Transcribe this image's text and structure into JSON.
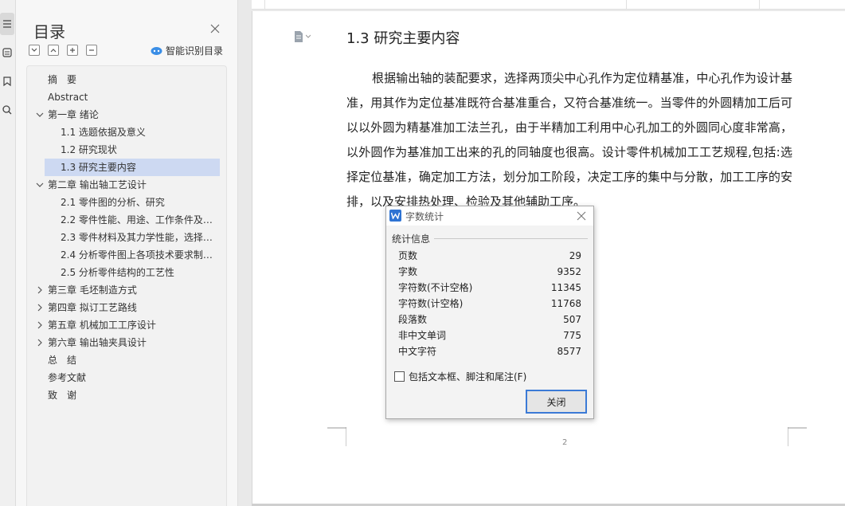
{
  "toc": {
    "title": "目录",
    "smart_label": "智能识别目录",
    "items": [
      {
        "label": "摘　要",
        "level": 0,
        "expander": "none",
        "selected": false
      },
      {
        "label": "Abstract",
        "level": 0,
        "expander": "none",
        "selected": false
      },
      {
        "label": "第一章 绪论",
        "level": 0,
        "expander": "expanded",
        "selected": false
      },
      {
        "label": "1.1 选题依据及意义",
        "level": 1,
        "expander": "none",
        "selected": false
      },
      {
        "label": "1.2 研究现状",
        "level": 1,
        "expander": "none",
        "selected": false
      },
      {
        "label": "1.3 研究主要内容",
        "level": 1,
        "expander": "none",
        "selected": true
      },
      {
        "label": "第二章 输出轴工艺设计",
        "level": 0,
        "expander": "expanded",
        "selected": false
      },
      {
        "label": "2.1 零件图的分析、研究",
        "level": 1,
        "expander": "none",
        "selected": false
      },
      {
        "label": "2.2 零件性能、用途、工作条件及…",
        "level": 1,
        "expander": "none",
        "selected": false
      },
      {
        "label": "2.3 零件材料及其力学性能，选择…",
        "level": 1,
        "expander": "none",
        "selected": false
      },
      {
        "label": "2.4 分析零件图上各项技术要求制…",
        "level": 1,
        "expander": "none",
        "selected": false
      },
      {
        "label": "2.5 分析零件结构的工艺性",
        "level": 1,
        "expander": "none",
        "selected": false
      },
      {
        "label": "第三章 毛坯制造方式",
        "level": 0,
        "expander": "collapsed",
        "selected": false
      },
      {
        "label": "第四章 拟订工艺路线",
        "level": 0,
        "expander": "collapsed",
        "selected": false
      },
      {
        "label": "第五章 机械加工工序设计",
        "level": 0,
        "expander": "collapsed",
        "selected": false
      },
      {
        "label": "第六章 输出轴夹具设计",
        "level": 0,
        "expander": "collapsed",
        "selected": false
      },
      {
        "label": "总　结",
        "level": 0,
        "expander": "none",
        "selected": false
      },
      {
        "label": "参考文献",
        "level": 0,
        "expander": "none",
        "selected": false
      },
      {
        "label": "致　谢",
        "level": 0,
        "expander": "none",
        "selected": false
      }
    ]
  },
  "document": {
    "heading": "1.3 研究主要内容",
    "paragraph": "根据输出轴的装配要求，选择两顶尖中心孔作为定位精基准，中心孔作为设计基准，用其作为定位基准既符合基准重合，又符合基准统一。当零件的外圆精加工后可以以外圆为精基准加工法兰孔，由于半精加工利用中心孔加工的外圆同心度非常高，以外圆作为基准加工出来的孔的同轴度也很高。设计零件机械加工工艺规程,包括:选择定位基准，确定加工方法，划分加工阶段，决定工序的集中与分散，加工工序的安排，以及安排热处理、检验及其他辅助工序。",
    "page_number": "2"
  },
  "dialog": {
    "title": "字数统计",
    "section_label": "统计信息",
    "stats": [
      {
        "label": "页数",
        "value": "29"
      },
      {
        "label": "字数",
        "value": "9352"
      },
      {
        "label": "字符数(不计空格)",
        "value": "11345"
      },
      {
        "label": "字符数(计空格)",
        "value": "11768"
      },
      {
        "label": "段落数",
        "value": "507"
      },
      {
        "label": "非中文单词",
        "value": "775"
      },
      {
        "label": "中文字符",
        "value": "8577"
      }
    ],
    "checkbox_label": "包括文本框、脚注和尾注(F)",
    "checkbox_checked": false,
    "close_label": "关闭"
  },
  "colors": {
    "selection": "#cdd9f2",
    "accent": "#3b7ad6",
    "wps_logo": "#2e73d3"
  }
}
